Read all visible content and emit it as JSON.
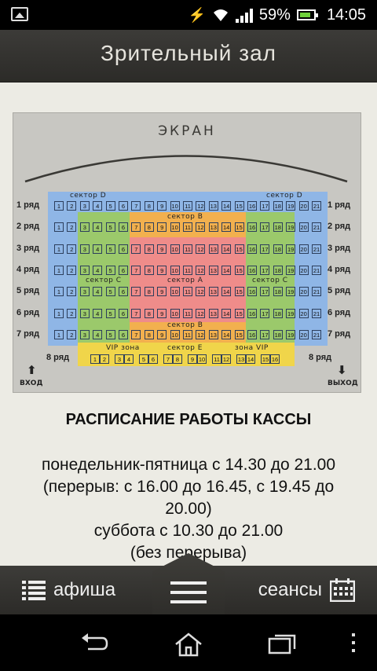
{
  "status_bar": {
    "battery": "59%",
    "time": "14:05"
  },
  "title": "Зрительный зал",
  "hall": {
    "screen": "ЭКРАН",
    "row_suffix": "ряд",
    "rows": [
      "1",
      "2",
      "3",
      "4",
      "5",
      "6",
      "7"
    ],
    "row8": "8 ряд",
    "sectors": {
      "d": "сектор D",
      "b": "сектор B",
      "c": "сектор C",
      "a": "сектор A",
      "e": "сектор Е",
      "vip_left": "VIP зона",
      "vip_right": "зона VIP"
    },
    "entrance": "ВХОД",
    "exit": "ВЫХОД",
    "colors": {
      "d": "#8fb6e6",
      "c": "#9bc96b",
      "b": "#f2b04e",
      "a": "#ef8c8a",
      "e": "#f0d54a"
    },
    "row8_seats": [
      "1",
      "2",
      "3",
      "4",
      "5",
      "6",
      "7",
      "8",
      "9",
      "10",
      "11",
      "12",
      "13",
      "14",
      "15",
      "16"
    ]
  },
  "schedule": {
    "heading": "РАСПИСАНИЕ РАБОТЫ КАССЫ",
    "lines": [
      "понедельник-пятница с 14.30 до 21.00",
      "(перерыв: с 16.00 до 16.45, с 19.45 до",
      "20.00)",
      "суббота с 10.30 до 21.00",
      "(без перерыва)"
    ]
  },
  "bottom_bar": {
    "afisha": "афиша",
    "seansy": "сеансы"
  }
}
